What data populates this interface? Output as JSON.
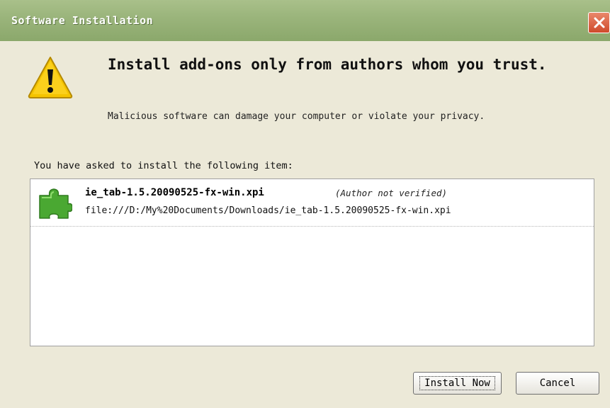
{
  "window": {
    "title": "Software Installation"
  },
  "icons": {
    "warning": "warning-triangle-icon",
    "close": "close-icon",
    "addon": "puzzle-piece-icon"
  },
  "message": {
    "headline": "Install add-ons only from authors whom you trust.",
    "subtext": "Malicious software can damage your computer or violate your privacy."
  },
  "list": {
    "label": "You have asked to install the following item:",
    "items": [
      {
        "name": "ie_tab-1.5.20090525-fx-win.xpi",
        "note": "(Author not verified)",
        "url": "file:///D:/My%20Documents/Downloads/ie_tab-1.5.20090525-fx-win.xpi"
      }
    ]
  },
  "buttons": {
    "install": "Install Now",
    "cancel": "Cancel"
  },
  "colors": {
    "titlebar": "#9bb57c",
    "dialog_bg": "#ECE9D8",
    "close": "#d9532f",
    "addon_green": "#4aa832",
    "warning": "#f5c400"
  }
}
